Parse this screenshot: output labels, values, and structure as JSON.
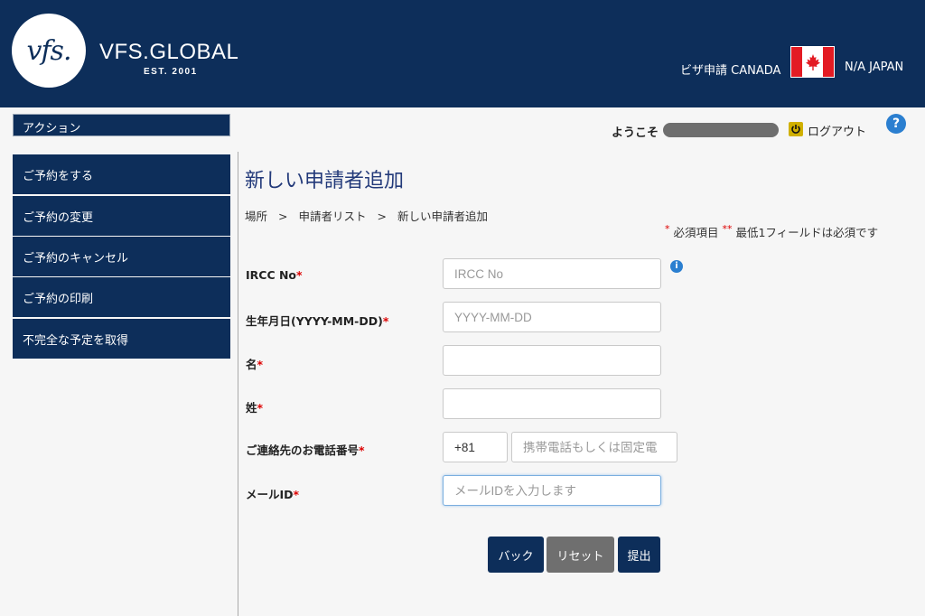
{
  "header": {
    "logo_text": "vfs.",
    "brand": "VFS.GLOBAL",
    "brand_sub": "EST. 2001",
    "visa_label": "ビザ申請 CANADA",
    "country": "N/A JAPAN"
  },
  "sidebar": {
    "heading": "アクション",
    "items": [
      {
        "label": "ご予約をする"
      },
      {
        "label": "ご予約の変更"
      },
      {
        "label": "ご予約のキャンセル"
      },
      {
        "label": "ご予約の印刷"
      },
      {
        "label": "不完全な予定を取得"
      }
    ]
  },
  "topbar": {
    "welcome": "ようこそ",
    "logout": "ログアウト",
    "help": "?"
  },
  "main": {
    "title": "新しい申請者追加",
    "breadcrumb": [
      "場所",
      "申請者リスト",
      "新しい申請者追加"
    ],
    "breadcrumb_sep": ">",
    "req_note_single": "必須項目",
    "req_note_double": "最低1フィールドは必須です"
  },
  "form": {
    "ircc_label": "IRCC No",
    "ircc_placeholder": "IRCC No",
    "dob_label": "生年月日(YYYY-MM-DD)",
    "dob_placeholder": "YYYY-MM-DD",
    "first_name_label": "名",
    "last_name_label": "姓",
    "phone_label": "ご連絡先のお電話番号",
    "phone_code": "+81",
    "phone_placeholder": "携帯電話もしくは固定電",
    "email_label": "メールID",
    "email_placeholder": "メールIDを入力します"
  },
  "buttons": {
    "back": "バック",
    "reset": "リセット",
    "submit": "提出"
  },
  "colors": {
    "brand_navy": "#0d2e5a",
    "required_red": "#d00000",
    "reset_gray": "#6f6f6f"
  }
}
